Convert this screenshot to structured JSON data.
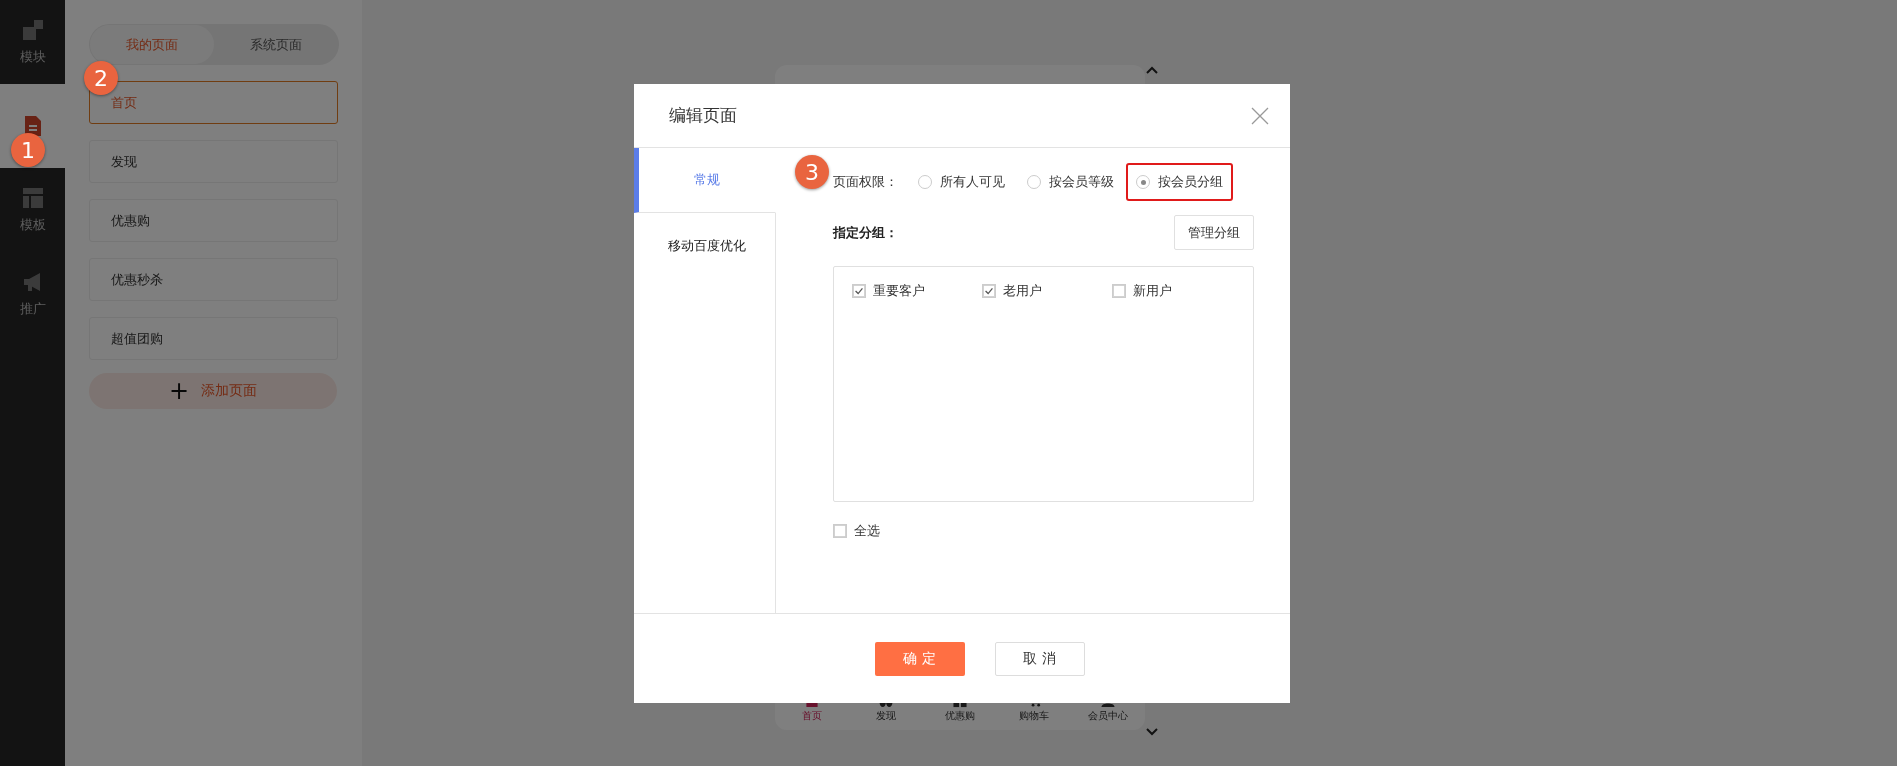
{
  "rail": {
    "items": [
      {
        "kind": "blocks",
        "label": "模块",
        "selected": false
      },
      {
        "kind": "page",
        "selected": true
      },
      {
        "kind": "layout",
        "label": "模板",
        "selected": false
      },
      {
        "kind": "megaphone",
        "label": "推广",
        "selected": false
      }
    ]
  },
  "pages_panel": {
    "tabs": [
      {
        "label": "我的页面",
        "selected": true
      },
      {
        "label": "系统页面",
        "selected": false
      }
    ],
    "pages": [
      {
        "label": "首页",
        "selected": true
      },
      {
        "label": "发现",
        "selected": false
      },
      {
        "label": "优惠购",
        "selected": false
      },
      {
        "label": "优惠秒杀",
        "selected": false
      },
      {
        "label": "超值团购",
        "selected": false
      }
    ],
    "add_button": {
      "icon": "+",
      "label": "添加页面"
    }
  },
  "preview": {
    "nav": [
      {
        "kind": "home",
        "label": "首页",
        "selected": true
      },
      {
        "kind": "discover",
        "label": "发现",
        "selected": false
      },
      {
        "kind": "grid",
        "label": "优惠购",
        "selected": false
      },
      {
        "kind": "cart",
        "label": "购物车",
        "selected": false
      },
      {
        "kind": "user",
        "label": "会员中心",
        "selected": false
      }
    ]
  },
  "dialog": {
    "title": "编辑页面",
    "tabs": [
      {
        "label": "常规",
        "selected": true
      },
      {
        "label": "移动百度优化",
        "selected": false
      }
    ],
    "permission": {
      "label": "页面权限：",
      "options": [
        {
          "label": "所有人可见",
          "selected": false
        },
        {
          "label": "按会员等级",
          "selected": false
        },
        {
          "label": "按会员分组",
          "selected": true,
          "highlighted": true
        }
      ]
    },
    "groups": {
      "label": "指定分组：",
      "manage_button": "管理分组",
      "items": [
        {
          "label": "重要客户",
          "checked": true
        },
        {
          "label": "老用户",
          "checked": true
        },
        {
          "label": "新用户",
          "checked": false
        }
      ]
    },
    "select_all": {
      "label": "全选",
      "checked": false
    },
    "buttons": [
      {
        "kind": "primary",
        "label": "确 定"
      },
      {
        "kind": "secondary",
        "label": "取 消"
      }
    ]
  },
  "callouts": [
    {
      "number": "1"
    },
    {
      "number": "2"
    },
    {
      "number": "3"
    }
  ]
}
